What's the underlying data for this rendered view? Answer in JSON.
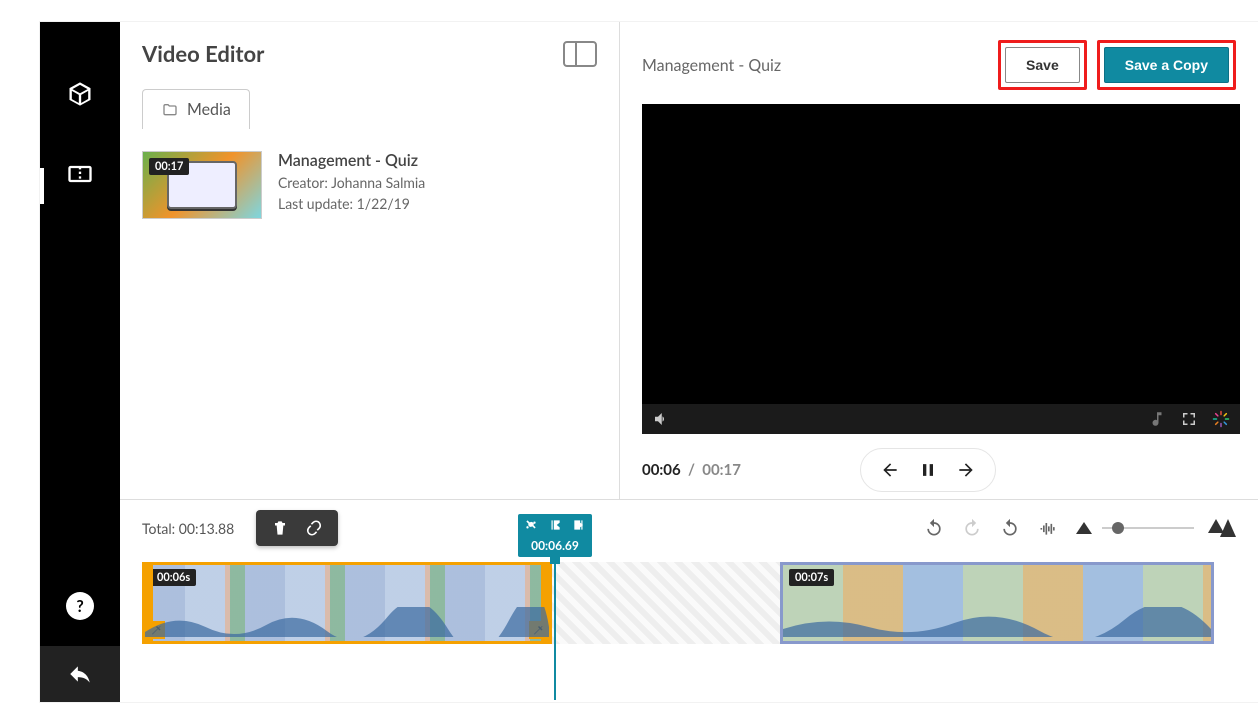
{
  "sidebar": {
    "icons": [
      "cube-icon",
      "timeline-icon"
    ],
    "help": "?",
    "back": "reply-icon"
  },
  "leftPane": {
    "title": "Video Editor",
    "tab_media": "Media",
    "media": {
      "title": "Management - Quiz",
      "creator": "Creator: Johanna Salmia",
      "updated": "Last update: 1/22/19",
      "duration": "00:17"
    }
  },
  "rightPane": {
    "title": "Management - Quiz",
    "save_label": "Save",
    "save_copy_label": "Save a Copy",
    "current_time": "00:06",
    "total_time": "00:17"
  },
  "bottom": {
    "total_label": "Total: 00:13.88",
    "cut_time": "00:06.69",
    "clipA_badge": "00:06s",
    "clipB_badge": "00:07s"
  }
}
